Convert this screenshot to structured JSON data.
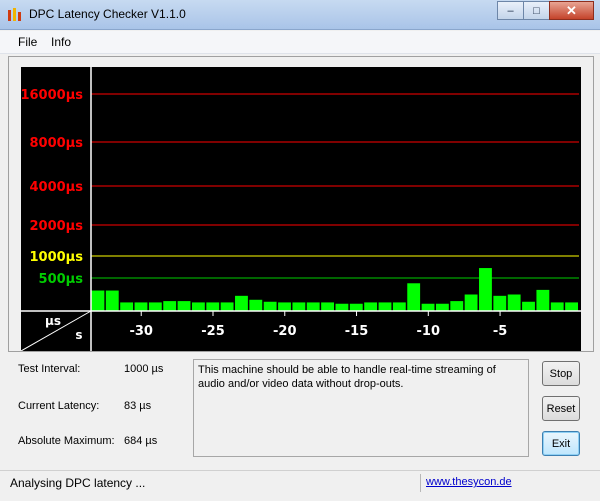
{
  "window": {
    "title": "DPC Latency Checker V1.1.0",
    "minimize": "–",
    "maximize": "□",
    "close": "✕"
  },
  "menu": {
    "items": [
      "File",
      "Info"
    ]
  },
  "chart_data": {
    "type": "bar",
    "y_scale": "log2-like",
    "y_unit": "µs",
    "x_unit": "s",
    "gridlines": [
      {
        "label": "16000µs",
        "value": 16000,
        "color": "#ff0000"
      },
      {
        "label": "8000µs",
        "value": 8000,
        "color": "#ff0000"
      },
      {
        "label": "4000µs",
        "value": 4000,
        "color": "#ff0000"
      },
      {
        "label": "2000µs",
        "value": 2000,
        "color": "#ff0000"
      },
      {
        "label": "1000µs",
        "value": 1000,
        "color": "#ffff00"
      },
      {
        "label": "500µs",
        "value": 500,
        "color": "#00cc00"
      }
    ],
    "x_ticks": [
      -30,
      -25,
      -20,
      -15,
      -10,
      -5
    ],
    "x_tick_labels": [
      "-30",
      "-25",
      "-20",
      "-15",
      "-10",
      "-5"
    ],
    "x_range": [
      -33,
      0
    ],
    "corner_labels": {
      "y": "µs",
      "x": "s"
    },
    "bar_color": "#00ff00",
    "background": "#000000",
    "bars": [
      {
        "x": -33,
        "value": 310
      },
      {
        "x": -32,
        "value": 310
      },
      {
        "x": -31,
        "value": 130
      },
      {
        "x": -30,
        "value": 130
      },
      {
        "x": -29,
        "value": 130
      },
      {
        "x": -28,
        "value": 150
      },
      {
        "x": -27,
        "value": 150
      },
      {
        "x": -26,
        "value": 130
      },
      {
        "x": -25,
        "value": 130
      },
      {
        "x": -24,
        "value": 130
      },
      {
        "x": -23,
        "value": 230
      },
      {
        "x": -22,
        "value": 170
      },
      {
        "x": -21,
        "value": 140
      },
      {
        "x": -20,
        "value": 130
      },
      {
        "x": -19,
        "value": 130
      },
      {
        "x": -18,
        "value": 130
      },
      {
        "x": -17,
        "value": 130
      },
      {
        "x": -16,
        "value": 110
      },
      {
        "x": -15,
        "value": 110
      },
      {
        "x": -14,
        "value": 130
      },
      {
        "x": -13,
        "value": 130
      },
      {
        "x": -12,
        "value": 130
      },
      {
        "x": -11,
        "value": 420
      },
      {
        "x": -10,
        "value": 110
      },
      {
        "x": -9,
        "value": 110
      },
      {
        "x": -8,
        "value": 150
      },
      {
        "x": -7,
        "value": 250
      },
      {
        "x": -6,
        "value": 684
      },
      {
        "x": -5,
        "value": 230
      },
      {
        "x": -4,
        "value": 250
      },
      {
        "x": -3,
        "value": 140
      },
      {
        "x": -2,
        "value": 320
      },
      {
        "x": -1,
        "value": 130
      },
      {
        "x": 0,
        "value": 130
      }
    ]
  },
  "info": {
    "test_interval_label": "Test Interval:",
    "test_interval_value": "1000 µs",
    "current_latency_label": "Current Latency:",
    "current_latency_value": "83 µs",
    "absolute_max_label": "Absolute Maximum:",
    "absolute_max_value": "684 µs"
  },
  "message": "This machine should be able to handle real-time streaming of audio and/or video data without drop-outs.",
  "buttons": {
    "stop": "Stop",
    "reset": "Reset",
    "exit": "Exit"
  },
  "status": {
    "text": "Analysing DPC latency ...",
    "link": "www.thesycon.de"
  }
}
